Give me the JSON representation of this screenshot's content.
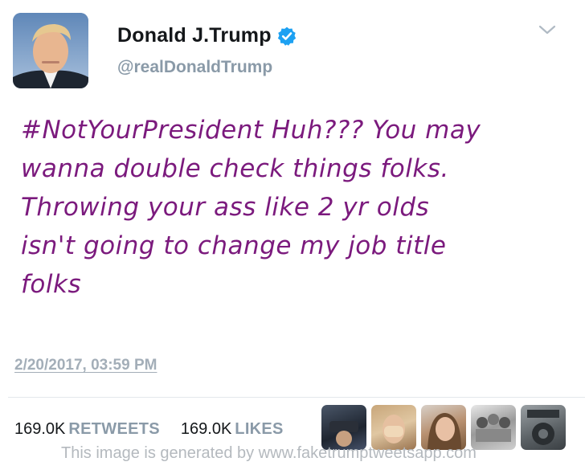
{
  "author": {
    "display_name": "Donald J.Trump",
    "handle": "@realDonaldTrump",
    "verified": true,
    "avatar_icon": "profile-photo"
  },
  "tweet": {
    "text": "#NotYourPresident Huh??? You may\nwanna double check things folks.\nThrowing your ass like 2 yr olds\nisn't going to change my job title\nfolks",
    "text_color": "#7b1a7d",
    "timestamp": "2/20/2017, 03:59 PM"
  },
  "stats": {
    "retweets_count": "169.0K",
    "retweets_label": "RETWEETS",
    "likes_count": "169.0K",
    "likes_label": "LIKES"
  },
  "liker_avatars": [
    "liker-avatar-1",
    "liker-avatar-2",
    "liker-avatar-3",
    "liker-avatar-4",
    "liker-avatar-5"
  ],
  "watermark": "This image is generated by www.faketrumptweetsapp.com",
  "colors": {
    "verified_badge": "#1da1f2",
    "muted_text": "#8a9aa8"
  }
}
